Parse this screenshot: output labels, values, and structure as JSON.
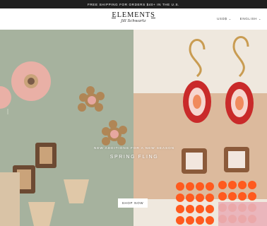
{
  "announcement": {
    "text": "FREE SHIPPING FOR ORDERS $40+ IN THE U.S."
  },
  "header": {
    "logo_main": "ELEMENTS",
    "logo_sub": "Jill Schwartz",
    "currency": {
      "label": "USD$"
    },
    "language": {
      "label": "ENGLISH"
    }
  },
  "hero": {
    "kicker": "NEW ADDITIONS FOR A NEW SEASON",
    "title": "SPRING FLING",
    "cta_label": "SHOP NOW"
  },
  "colors": {
    "announcement_bg": "#1f1f1f",
    "left_panel_bg": "#a6b29e",
    "right_panel_bg": "#efe8de",
    "accent_red": "#c92a2a",
    "accent_orange": "#ff5a1e"
  },
  "icons": [
    "chevron-down-icon"
  ]
}
